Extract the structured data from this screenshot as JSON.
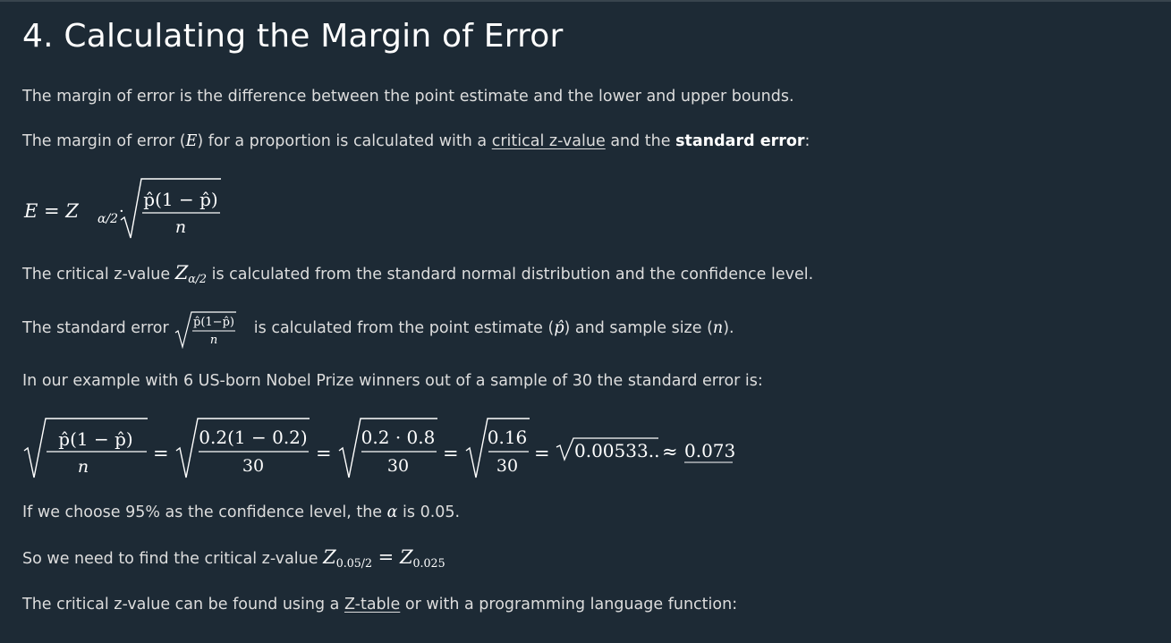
{
  "heading": "4. Calculating the Margin of Error",
  "p1": "The margin of error is the difference between the point estimate and the lower and upper bounds.",
  "p2": {
    "a": "The margin of error (",
    "var": "E",
    "b": ") for a proportion is calculated with a ",
    "link": "critical z-value",
    "c": " and the ",
    "bold": "standard error",
    "d": ":"
  },
  "formula1": {
    "lhs": "E = Z",
    "sub": "α/2",
    "dot": "·",
    "num": "p̂(1 − p̂)",
    "den": "n"
  },
  "p3": {
    "a": "The critical z-value ",
    "var": "Z",
    "sub": "α/2",
    "b": " is calculated from the standard normal distribution and the confidence level."
  },
  "p4": {
    "a": "The standard error ",
    "num": "p̂(1−p̂)",
    "den": "n",
    "b": " is calculated from the point estimate (",
    "phat": "p̂",
    "c": ") and sample size (",
    "n": "n",
    "d": ")."
  },
  "p5": "In our example with 6 US-born Nobel Prize winners out of a sample of 30 the standard error is:",
  "formula2": {
    "t1_num": "p̂(1 − p̂)",
    "t1_den": "n",
    "t2_num": "0.2(1 − 0.2)",
    "t2_den": "30",
    "t3_num": "0.2 · 0.8",
    "t3_den": "30",
    "t4_num": "0.16",
    "t4_den": "30",
    "eq": "=",
    "t5": "0.00533..",
    "approx": "≈",
    "result": "0.073"
  },
  "p6": {
    "a": "If we choose 95% as the confidence level, the ",
    "alpha": "α",
    "b": " is 0.05."
  },
  "p7": {
    "a": "So we need to find the critical z-value ",
    "z1": "Z",
    "sub1": "0.05/2",
    "eq": " = ",
    "z2": "Z",
    "sub2": "0.025"
  },
  "p8": {
    "a": "The critical z-value can be found using a ",
    "link": "Z-table",
    "b": " or with a programming language function:"
  }
}
